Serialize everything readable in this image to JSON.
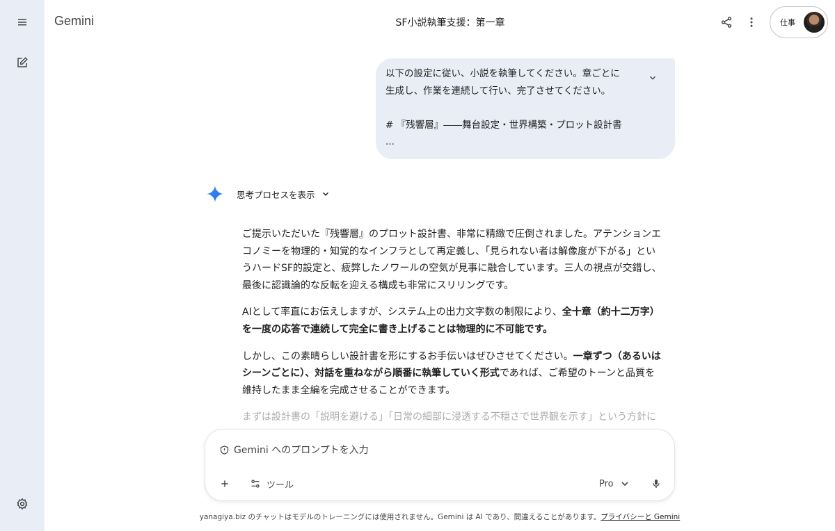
{
  "app": {
    "name": "Gemini"
  },
  "header": {
    "title": "SF小説執筆支援：第一章",
    "account_label": "仕事"
  },
  "icons": {
    "menu": "menu-icon",
    "new_chat": "edit-icon",
    "settings": "gear-icon",
    "share": "share-icon",
    "more": "more-vert-icon",
    "spark": "gemini-spark-icon",
    "mic": "mic-icon"
  },
  "user_message": {
    "lines": [
      "以下の設定に従い、小説を執筆してください。章ごとに",
      "生成し、作業を連続して行い、完了させてください。",
      "",
      "# 『残響層』――舞台設定・世界構築・プロット設計書",
      "..."
    ]
  },
  "response": {
    "thinking_label": "思考プロセスを表示",
    "p1": [
      "ご提示いただいた『残響層』のプロット設計書、非常に精緻で圧倒されました。アテンションエ",
      "コノミーを物理的・知覚的なインフラとして再定義し、「見られない者は解像度が下がる」とい",
      "うハードSF的設定と、疲弊したノワールの空気が見事に融合しています。三人の視点が交錯し、",
      "最後に認識論的な反転を迎える構成も非常にスリリングです。"
    ],
    "p2_l1_normal": "AIとして率直にお伝えしますが、システム上の出力文字数の制限により、",
    "p2_l1_bold": "全十章（約十二万字）",
    "p2_l2_bold": "を一度の応答で連続して完全に書き上げることは物理的に不可能です。",
    "p3_l1_normal": "しかし、この素晴らしい設計書を形にするお手伝いはぜひさせてください。",
    "p3_l1_bold": "一章ずつ（あるいは",
    "p3_l2_bold": "シーンごとに）、対話を重ねながら順番に執筆していく形式",
    "p3_l2_normal": "であれば、ご希望のトーンと品質を",
    "p3_l3": "維持したまま全編を完成させることができます。",
    "p4_faded": "まずは設計書の「説明を避ける」「日常の細部に浸透する不穏さで世界観を示す」という方針に"
  },
  "composer": {
    "placeholder": "Gemini へのプロンプトを入力",
    "tools_label": "ツール",
    "model_label": "Pro"
  },
  "footer": {
    "text": "yanagiya.biz のチャットはモデルのトレーニングには使用されません。Gemini は AI であり、間違えることがあります。",
    "link": "プライバシーと Gemini"
  },
  "colors": {
    "rail_bg": "#e9eef6",
    "bubble_bg": "#e9eef6",
    "text": "#1f1f1f",
    "muted": "#444746",
    "faded": "#a9acab"
  }
}
